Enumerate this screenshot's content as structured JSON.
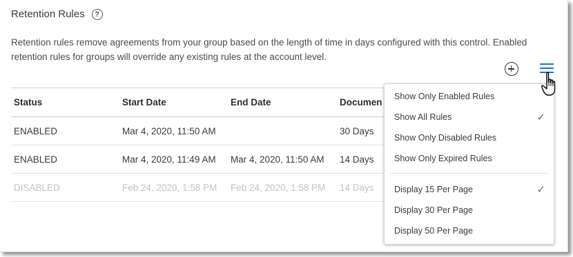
{
  "header": {
    "title": "Retention Rules",
    "help_icon_glyph": "?",
    "description": "Retention rules remove agreements from your group based on the length of time in days configured with this control. Enabled retention rules for groups will override any existing rules at the account level."
  },
  "toolbar": {
    "add_icon": "plus-circle-icon",
    "menu_icon": "hamburger-menu-icon",
    "menu_icon_color": "#1473e6"
  },
  "table": {
    "columns": [
      "Status",
      "Start Date",
      "End Date",
      "Documen"
    ],
    "rows": [
      {
        "status": "ENABLED",
        "start": "Mar 4, 2020, 11:50 AM",
        "end": "",
        "docs": "30 Days",
        "disabled": false
      },
      {
        "status": "ENABLED",
        "start": "Mar 4, 2020, 11:49 AM",
        "end": "Mar 4, 2020, 11:50 AM",
        "docs": "14 Days",
        "disabled": false
      },
      {
        "status": "DISABLED",
        "start": "Feb 24, 2020, 1:58 PM",
        "end": "Feb 24, 2020, 1:58 PM",
        "docs": "14 Days",
        "disabled": true
      }
    ]
  },
  "dropdown": {
    "filter_items": [
      {
        "label": "Show Only Enabled Rules",
        "checked": false
      },
      {
        "label": "Show All Rules",
        "checked": true
      },
      {
        "label": "Show Only Disabled Rules",
        "checked": false
      },
      {
        "label": "Show Only Expired Rules",
        "checked": false
      }
    ],
    "page_size_items": [
      {
        "label": "Display 15 Per Page",
        "checked": true
      },
      {
        "label": "Display 30 Per Page",
        "checked": false
      },
      {
        "label": "Display 50 Per Page",
        "checked": false
      }
    ],
    "check_glyph": "✓"
  }
}
